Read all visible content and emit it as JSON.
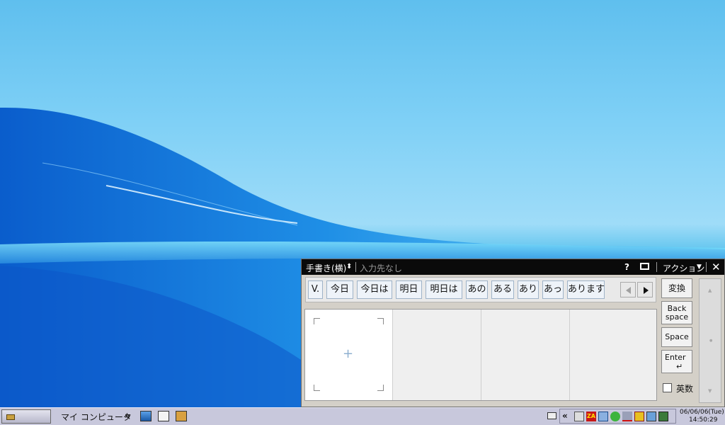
{
  "ime": {
    "mode_label": "手書き(横)",
    "mode_arrow": "⬍",
    "target_label": "入力先なし",
    "help_label": "?",
    "keyboard_icon": "keyboard-icon",
    "action_label": "アクション",
    "action_arrow": "▼",
    "close_label": "✕",
    "candidates": [
      "V.",
      "今日",
      "今日は",
      "明日",
      "明日は",
      "あの",
      "ある",
      "あり",
      "あっ",
      "あります"
    ],
    "keys": {
      "convert": "変換",
      "backspace_1": "Back",
      "backspace_2": "space",
      "space": "Space",
      "enter": "Enter",
      "enter_glyph": "↵"
    },
    "eisu_label": "英数",
    "eisu_checked": false,
    "plus_glyph": "+",
    "scroll_up": "▲",
    "scroll_mid": "●",
    "scroll_down": "▼"
  },
  "taskbar": {
    "my_computer_label": "マイ コンピュータ",
    "chevron_right": "»",
    "chevron_left": "«",
    "quicklaunch_icons": [
      "ie-icon",
      "mail-icon",
      "book-icon"
    ],
    "tray_icons": [
      "pen-icon",
      "ime-za-icon",
      "network-arrows-icon",
      "check-icon",
      "speaker-muted-icon",
      "hand-icon",
      "photo-icon",
      "lan-icon"
    ],
    "tray_za_text": "ZA",
    "clock_date": "06/06/06(Tue)",
    "clock_time": "14:50:29"
  },
  "colors": {
    "title_bar": "#0a0a0a",
    "panel": "#d4d0c8",
    "taskbar": "#c8c8dc",
    "desktop_sky": "#7fd0f6",
    "desktop_wave": "#1778d8"
  }
}
